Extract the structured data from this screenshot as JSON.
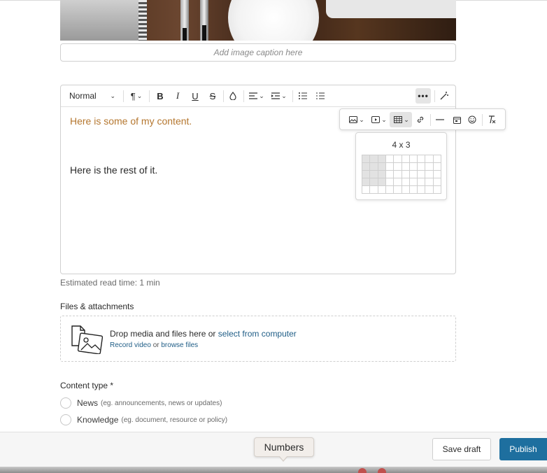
{
  "caption": {
    "placeholder": "Add image caption here"
  },
  "toolbar": {
    "text_style": "Normal",
    "items": [
      "paragraph-icon",
      "bold-icon",
      "italic-icon",
      "underline-icon",
      "strikethrough-icon",
      "color-icon",
      "align-icon",
      "indent-icon",
      "bullet-list-icon",
      "numbered-list-icon",
      "more-icon",
      "magic-wand-icon"
    ]
  },
  "subtoolbar": {
    "items": [
      "image-icon",
      "video-icon",
      "table-icon",
      "link-icon",
      "horizontal-rule-icon",
      "calendar-icon",
      "emoji-icon",
      "clear-format-icon"
    ]
  },
  "editor": {
    "line1": "Here is some of my content.",
    "line2": "Here is the rest of it."
  },
  "table_picker": {
    "size_label": "4 x 3",
    "cols": 10,
    "rows": 5,
    "selected_cols": 3,
    "selected_rows": 4
  },
  "read_time": "Estimated read time: 1 min",
  "files": {
    "title": "Files & attachments",
    "drop_text": "Drop media and files here or ",
    "select_link": "select from computer",
    "record_link": "Record video",
    "or_text": " or ",
    "browse_link": "browse files"
  },
  "content_type": {
    "title": "Content type *",
    "options": [
      {
        "label": "News",
        "hint": "(eg. announcements, news or updates)"
      },
      {
        "label": "Knowledge",
        "hint": "(eg. document, resource or policy)"
      }
    ]
  },
  "footer": {
    "tooltip": "Numbers",
    "save_draft": "Save draft",
    "publish": "Publish"
  },
  "colors": {
    "accent": "#1e6f9f",
    "highlight_text": "#b5772f",
    "link": "#1f5d86"
  }
}
